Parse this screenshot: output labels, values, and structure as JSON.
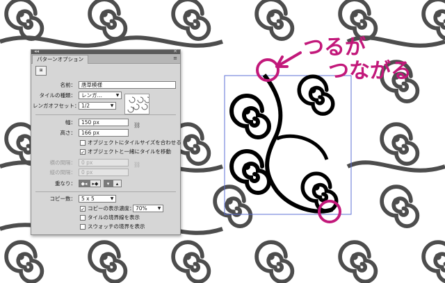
{
  "panel": {
    "tab_label": "パターンオプション",
    "collapse_glyph": "◂◂",
    "close_glyph": "✕",
    "menu_glyph": "≡",
    "tile_tool_glyph": "⊞",
    "name_label": "名前：",
    "name_value": "唐草模様",
    "tile_type_label": "タイルの種類：",
    "tile_type_value": "レンガ…",
    "brick_offset_label": "レンガオフセット：",
    "brick_offset_value": "1/2",
    "width_label": "幅：",
    "width_value": "150 px",
    "height_label": "高さ：",
    "height_value": "166 px",
    "size_to_art_label": "オブジェクトにタイルサイズを合わせる",
    "size_to_art_checked": false,
    "move_with_art_label": "オブジェクトと一緒にタイルを移動",
    "move_with_art_checked": true,
    "h_spacing_label": "横の間隔：",
    "h_spacing_value": "0 px",
    "v_spacing_label": "縦の間隔：",
    "v_spacing_value": "0 px",
    "overlap_label": "重なり：",
    "copies_label": "コピー数：",
    "copies_value": "5 x 5",
    "dim_copies_label": "コピーの表示濃度：",
    "dim_copies_checked": true,
    "dim_copies_value": "70%",
    "show_tile_edge_label": "タイルの境界線を表示",
    "show_tile_edge_checked": false,
    "show_swatch_bounds_label": "スウォッチの境界を表示",
    "show_swatch_bounds_checked": false
  },
  "annotation": {
    "line1": "つるが",
    "line2": "つながる",
    "color": "#c2187a"
  },
  "colors": {
    "pattern_gray": "#4d4d4d",
    "pattern_black": "#000000",
    "tile_bounds": "#5b6fd6"
  }
}
